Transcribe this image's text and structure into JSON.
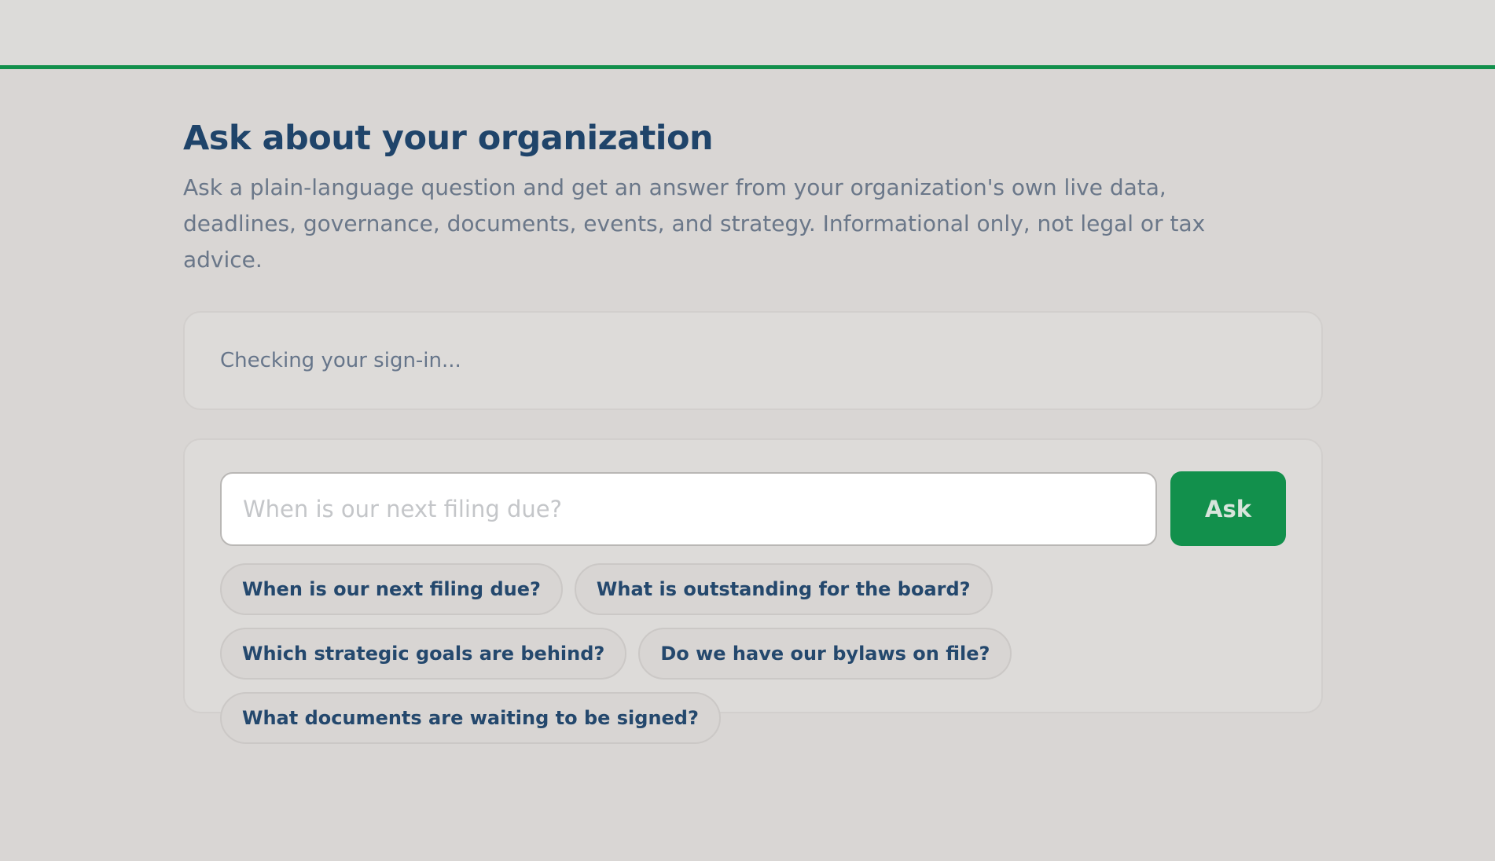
{
  "header": {
    "accent_color": "#12904c"
  },
  "page": {
    "title": "Ask about your organization",
    "intro": "Ask a plain-language question and get an answer from your organization's own live data, deadlines, governance, documents, events, and strategy. Informational only, not legal or tax advice."
  },
  "status": {
    "text": "Checking your sign-in..."
  },
  "ask": {
    "input_value": "",
    "placeholder": "When is our next filing due?",
    "button_label": "Ask",
    "suggestions": [
      "When is our next filing due?",
      "What is outstanding for the board?",
      "Which strategic goals are behind?",
      "Do we have our bylaws on file?",
      "What documents are waiting to be signed?"
    ]
  }
}
